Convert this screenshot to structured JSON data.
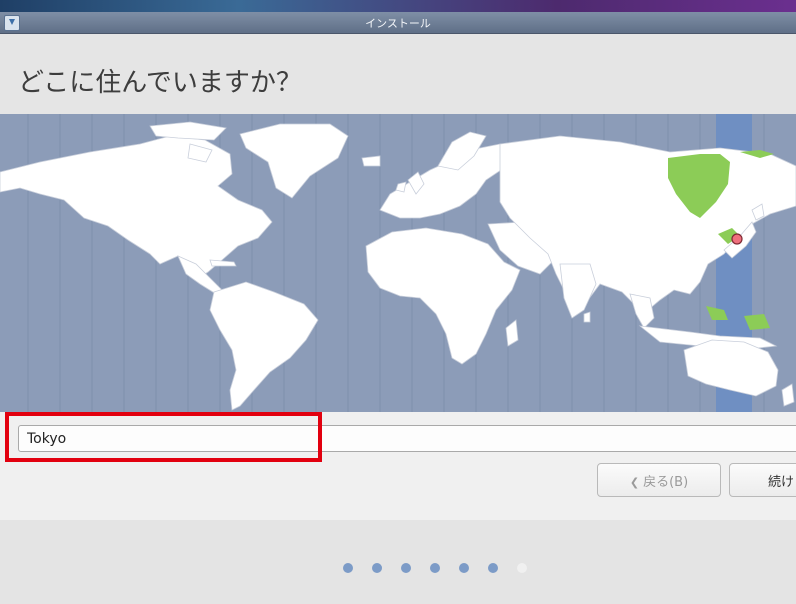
{
  "window": {
    "title": "インストール",
    "app_icon": "installer-icon"
  },
  "page": {
    "title": "どこに住んでいますか？"
  },
  "map": {
    "description_icon": "world-timezone-map",
    "selected_city_marker": "map-pin-icon",
    "colors": {
      "ocean": "#8c9cb8",
      "land": "#ffffff",
      "highlight_region": "#8ccc57",
      "selected_timezone_band": "#6f8fc2",
      "pin": "#ef6f7d"
    }
  },
  "location": {
    "value": "Tokyo"
  },
  "buttons": {
    "back": "戻る(B)",
    "back_icon": "chevron-left-icon",
    "continue": "続け"
  },
  "progress": {
    "total_steps": 7,
    "completed_steps": 6
  }
}
